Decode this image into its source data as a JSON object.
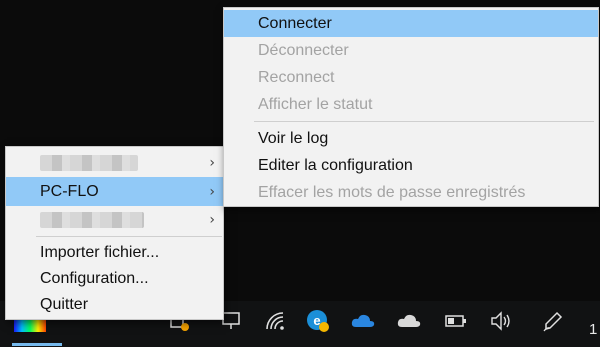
{
  "submenu": {
    "items": [
      {
        "label": "Connecter",
        "disabled": false,
        "highlighted": true
      },
      {
        "label": "Déconnecter",
        "disabled": true,
        "highlighted": false
      },
      {
        "label": "Reconnect",
        "disabled": true,
        "highlighted": false
      },
      {
        "label": "Afficher le statut",
        "disabled": true,
        "highlighted": false
      },
      {
        "label": "Voir le log",
        "disabled": false,
        "highlighted": false
      },
      {
        "label": "Editer la configuration",
        "disabled": false,
        "highlighted": false
      },
      {
        "label": "Effacer les mots de passe enregistrés",
        "disabled": true,
        "highlighted": false
      }
    ]
  },
  "main_menu": {
    "connections": [
      {
        "label": "",
        "redacted": true,
        "has_submenu": true
      },
      {
        "label": "PC-FLO",
        "redacted": false,
        "has_submenu": true,
        "highlighted": true
      },
      {
        "label": "",
        "redacted": true,
        "has_submenu": true
      }
    ],
    "actions": [
      {
        "label": "Importer fichier..."
      },
      {
        "label": "Configuration..."
      },
      {
        "label": "Quitter"
      }
    ],
    "chevron_glyph": "›"
  },
  "taskbar": {
    "clock_fragment": "1",
    "icons": [
      "openvpn-app-icon",
      "network-shield-icon",
      "display-icon",
      "wifi-icon",
      "edge-update-icon",
      "onedrive-icon",
      "onedrive-personal-icon",
      "battery-icon",
      "volume-icon",
      "pen-icon"
    ]
  },
  "colors": {
    "highlight": "#91c9f7",
    "menu_bg": "#f2f2f2",
    "disabled_text": "#a3a3a3"
  }
}
